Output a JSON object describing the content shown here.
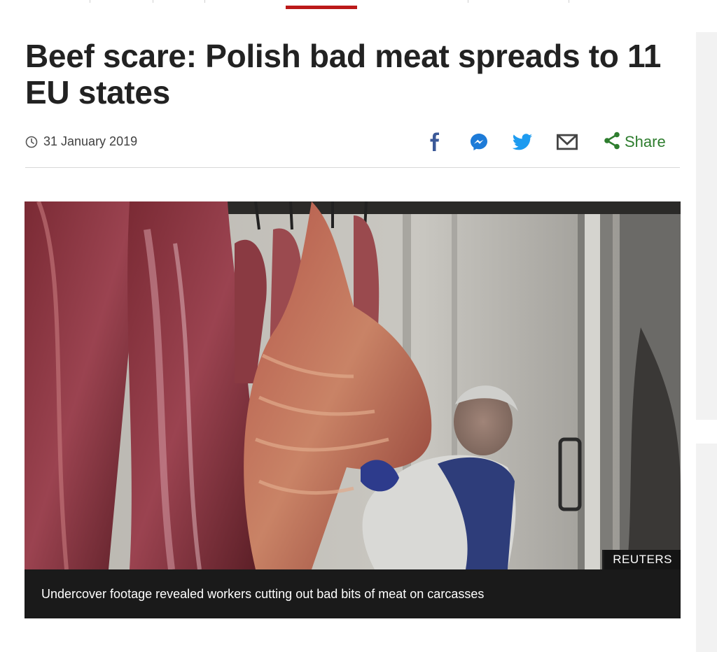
{
  "article": {
    "headline": "Beef scare: Polish bad meat spreads to 11 EU states",
    "date": "31 January 2019"
  },
  "share": {
    "label": "Share",
    "icons": [
      "facebook-icon",
      "messenger-icon",
      "twitter-icon",
      "email-icon",
      "share-icon"
    ]
  },
  "media": {
    "credit": "REUTERS",
    "caption": "Undercover footage revealed workers cutting out bad bits of meat on carcasses"
  },
  "colors": {
    "accent": "#bb1919",
    "share_green": "#2e7d2e",
    "icon_blue": "#1d7bd8",
    "facebook_blue": "#3b5998"
  }
}
